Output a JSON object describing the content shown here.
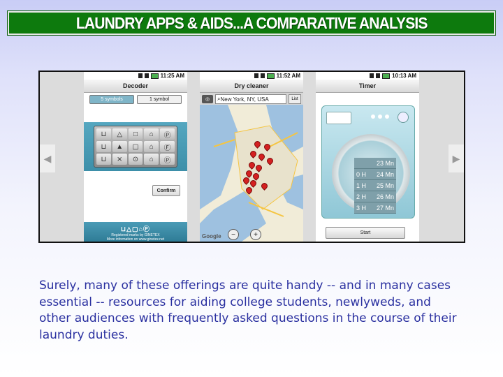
{
  "slide": {
    "title": "LAUNDRY APPS & AIDS...A COMPARATIVE ANALYSIS",
    "caption": "Surely, many of these offerings are quite handy -- and in many cases essential -- resources for aiding college students, newlyweds, and other audiences with frequently asked questions in the course of their laundry duties."
  },
  "gallery": {
    "nav": {
      "prev_icon": "arrow-left-icon",
      "next_icon": "arrow-right-icon"
    },
    "screens": [
      {
        "time": "11:25 AM",
        "title": "Decoder",
        "tabs": [
          "5 symbols",
          "1 symbol"
        ],
        "confirm": "Confirm",
        "footer_credit": "Registered marks by GINETEX",
        "footer_more": "More information on www.ginetex.net"
      },
      {
        "time": "11:52 AM",
        "title": "Dry cleaner",
        "search_value": "New York, NY, USA",
        "list_label": "List",
        "map_brand": "Google"
      },
      {
        "time": "10:13 AM",
        "title": "Timer",
        "timer_rows": [
          {
            "h": "",
            "m": "23 Mn"
          },
          {
            "h": "0 H",
            "m": "24 Mn"
          },
          {
            "h": "1 H",
            "m": "25 Mn"
          },
          {
            "h": "2 H",
            "m": "26 Mn"
          },
          {
            "h": "3 H",
            "m": "27 Mn"
          }
        ],
        "start": "Start"
      }
    ]
  },
  "colors": {
    "title_bg": "#0d7a0d",
    "caption": "#2a30a0",
    "accent_teal": "#4b9bb6"
  }
}
